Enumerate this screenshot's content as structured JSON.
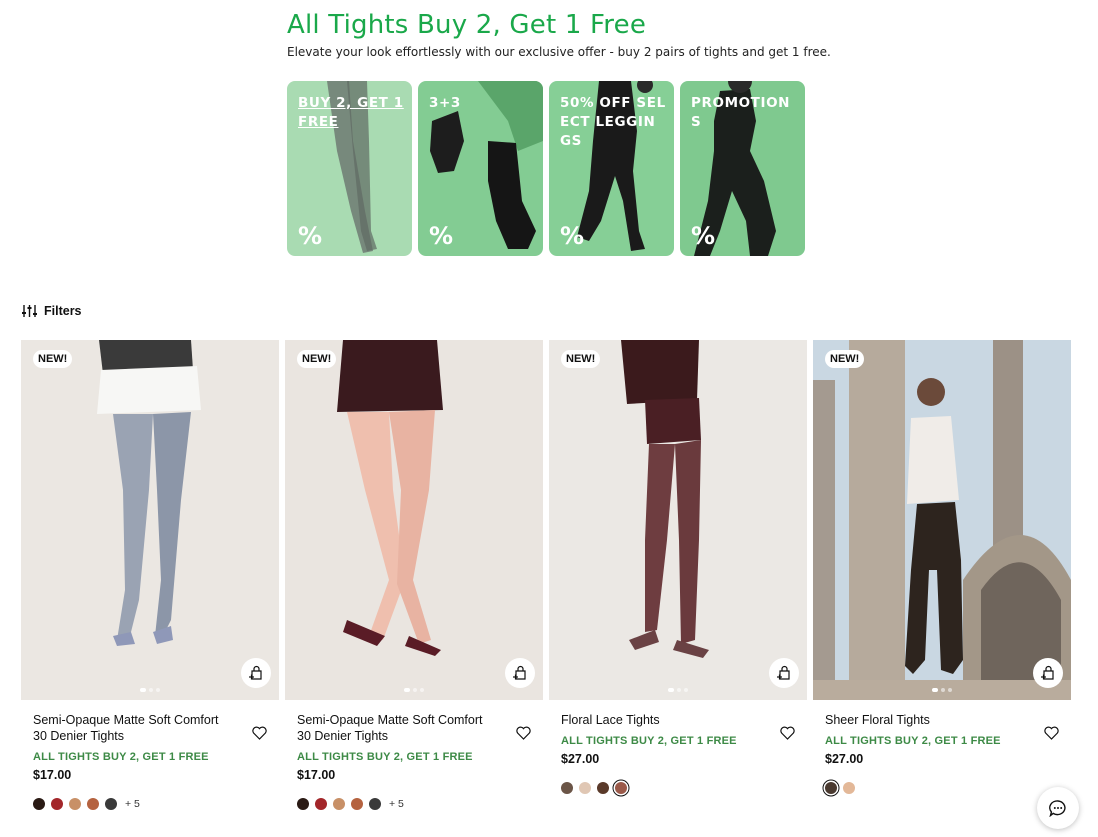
{
  "promo": {
    "title": "All Tights Buy 2, Get 1 Free",
    "subtitle": "Elevate your look effortlessly with our exclusive offer - buy 2 pairs of tights and get 1 free."
  },
  "tiles": [
    {
      "label": "BUY 2, GET 1 FREE",
      "percent": "%"
    },
    {
      "label": "3+3",
      "percent": "%"
    },
    {
      "label": "50% OFF SELECT LEGGINGS",
      "percent": "%"
    },
    {
      "label": "PROMOTIONS",
      "percent": "%"
    }
  ],
  "filters": {
    "label": "Filters",
    "icon": "sliders-icon"
  },
  "products": [
    {
      "badge": "NEW!",
      "name": "Semi-Opaque Matte Soft Comfort 30 Denier Tights",
      "offer": "ALL TIGHTS BUY 2, GET 1 FREE",
      "price": "$17.00",
      "swatches": [
        "#2a1a14",
        "#a3262a",
        "#c89067",
        "#b5623f",
        "#3a3a3a"
      ],
      "more": "+ 5",
      "image_slides": 3
    },
    {
      "badge": "NEW!",
      "name": "Semi-Opaque Matte Soft Comfort 30 Denier Tights",
      "offer": "ALL TIGHTS BUY 2, GET 1 FREE",
      "price": "$17.00",
      "swatches": [
        "#2a1a14",
        "#a3262a",
        "#c89067",
        "#b5623f",
        "#3a3a3a"
      ],
      "more": "+ 5",
      "image_slides": 3
    },
    {
      "badge": "NEW!",
      "name": "Floral Lace Tights",
      "offer": "ALL TIGHTS BUY 2, GET 1 FREE",
      "price": "$27.00",
      "swatches": [
        "#6b5547",
        "#e0c7b4",
        "#5a3a2a",
        "#9b5a4a"
      ],
      "more": "",
      "image_slides": 3
    },
    {
      "badge": "NEW!",
      "name": "Sheer Floral Tights",
      "offer": "ALL TIGHTS BUY 2, GET 1 FREE",
      "price": "$27.00",
      "swatches": [
        "#4a3a30",
        "#e3b898"
      ],
      "more": "",
      "image_slides": 3
    }
  ],
  "colors": {
    "accent_green": "#1aa84a",
    "offer_green": "#3d8a46",
    "tile_green": "#7fc98f"
  },
  "chat": {
    "icon": "chat-bubble-icon"
  }
}
